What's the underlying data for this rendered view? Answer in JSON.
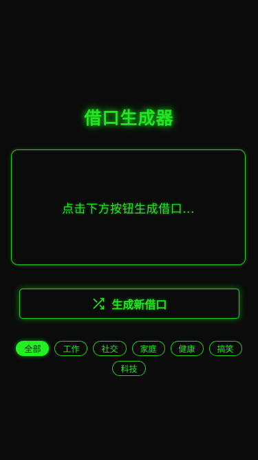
{
  "app": {
    "title": "借口生成器"
  },
  "excuse": {
    "text": "点击下方按钮生成借口..."
  },
  "generate_button": {
    "label": "生成新借口",
    "icon": "shuffle-icon"
  },
  "categories": [
    {
      "label": "全部",
      "active": true
    },
    {
      "label": "工作",
      "active": false
    },
    {
      "label": "社交",
      "active": false
    },
    {
      "label": "家庭",
      "active": false
    },
    {
      "label": "健康",
      "active": false
    },
    {
      "label": "搞笑",
      "active": false
    },
    {
      "label": "科技",
      "active": false
    }
  ],
  "colors": {
    "background": "#0b0b0b",
    "accent": "#22e622",
    "active_chip": "#22f022"
  }
}
